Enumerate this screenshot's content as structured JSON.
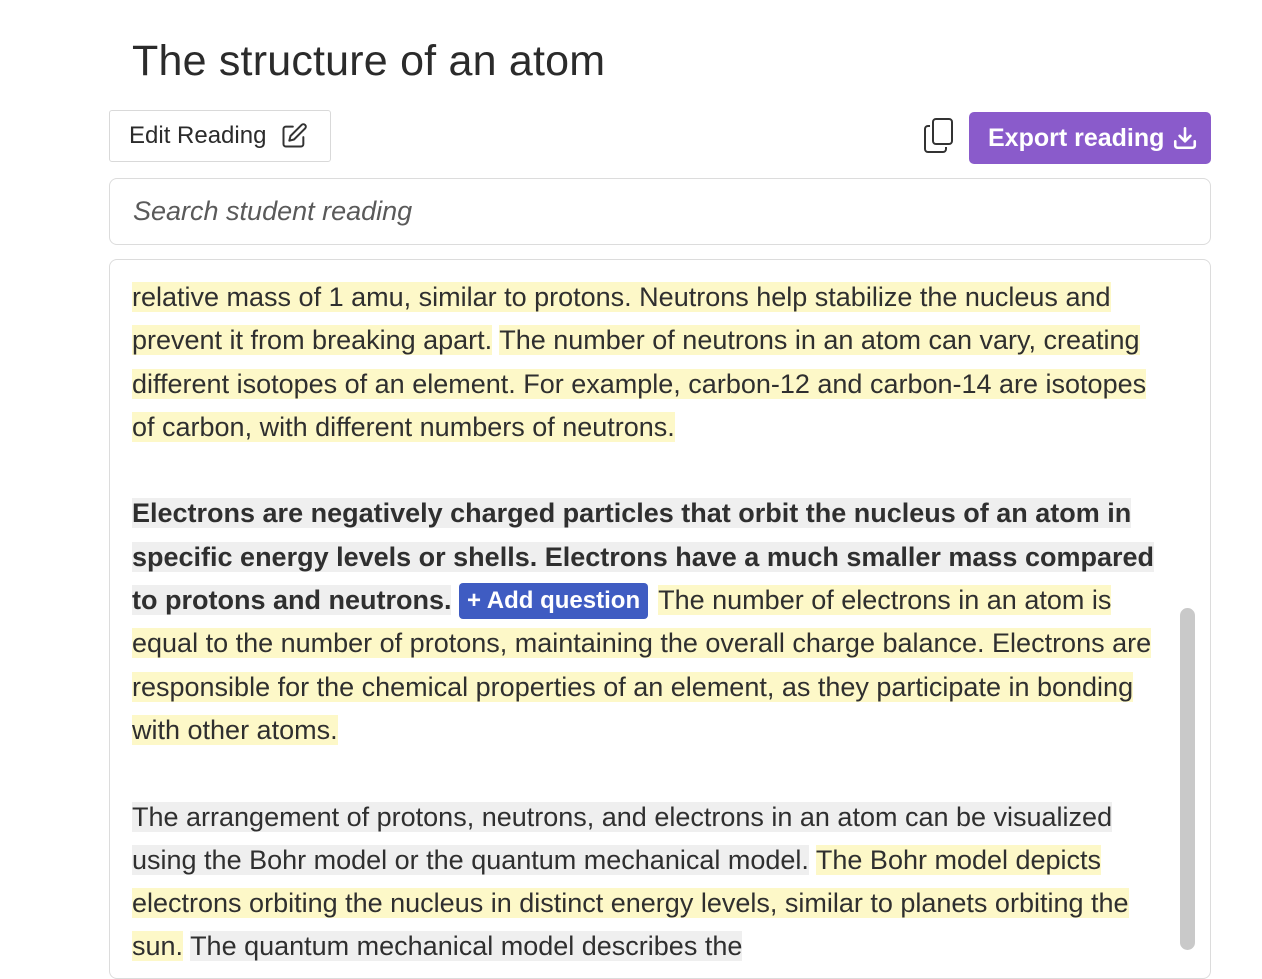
{
  "header": {
    "title": "The structure of an atom"
  },
  "toolbar": {
    "edit_label": "Edit Reading",
    "export_label": "Export reading"
  },
  "search": {
    "placeholder": "Search student reading"
  },
  "reading": {
    "p1": {
      "s1": "relative mass of 1 amu, similar to protons. Neutrons help stabilize the nucleus and prevent it from breaking apart.",
      "s2": "The number of neutrons in an atom can vary, creating different isotopes of an element. For example, carbon-12 and carbon-14 are isotopes of carbon, with different numbers of neutrons."
    },
    "p2": {
      "s1": "Electrons are negatively charged particles that orbit the nucleus of an atom in specific energy levels or shells. Electrons have a much smaller mass compared to protons and neutrons.",
      "add_question": "+ Add question",
      "s2": "The number of electrons in an atom is equal to the number of protons, maintaining the overall charge balance. Electrons are responsible for the chemical properties of an element, as they participate in bonding with other atoms."
    },
    "p3": {
      "s1": "The arrangement of protons, neutrons, and electrons in an atom can be visualized using the Bohr model or the quantum mechanical model.",
      "s2": "The Bohr model depicts electrons orbiting the nucleus in distinct energy levels, similar to planets orbiting the sun.",
      "s3": "The quantum mechanical model describes the"
    }
  },
  "colors": {
    "export_button": "#8a5bcb",
    "add_question_button": "#3f5cc2",
    "highlight_yellow": "#fdf8c8",
    "highlight_gray": "#efefef"
  },
  "icons": {
    "edit": "edit-icon",
    "copy": "copy-icon",
    "download": "download-icon"
  }
}
